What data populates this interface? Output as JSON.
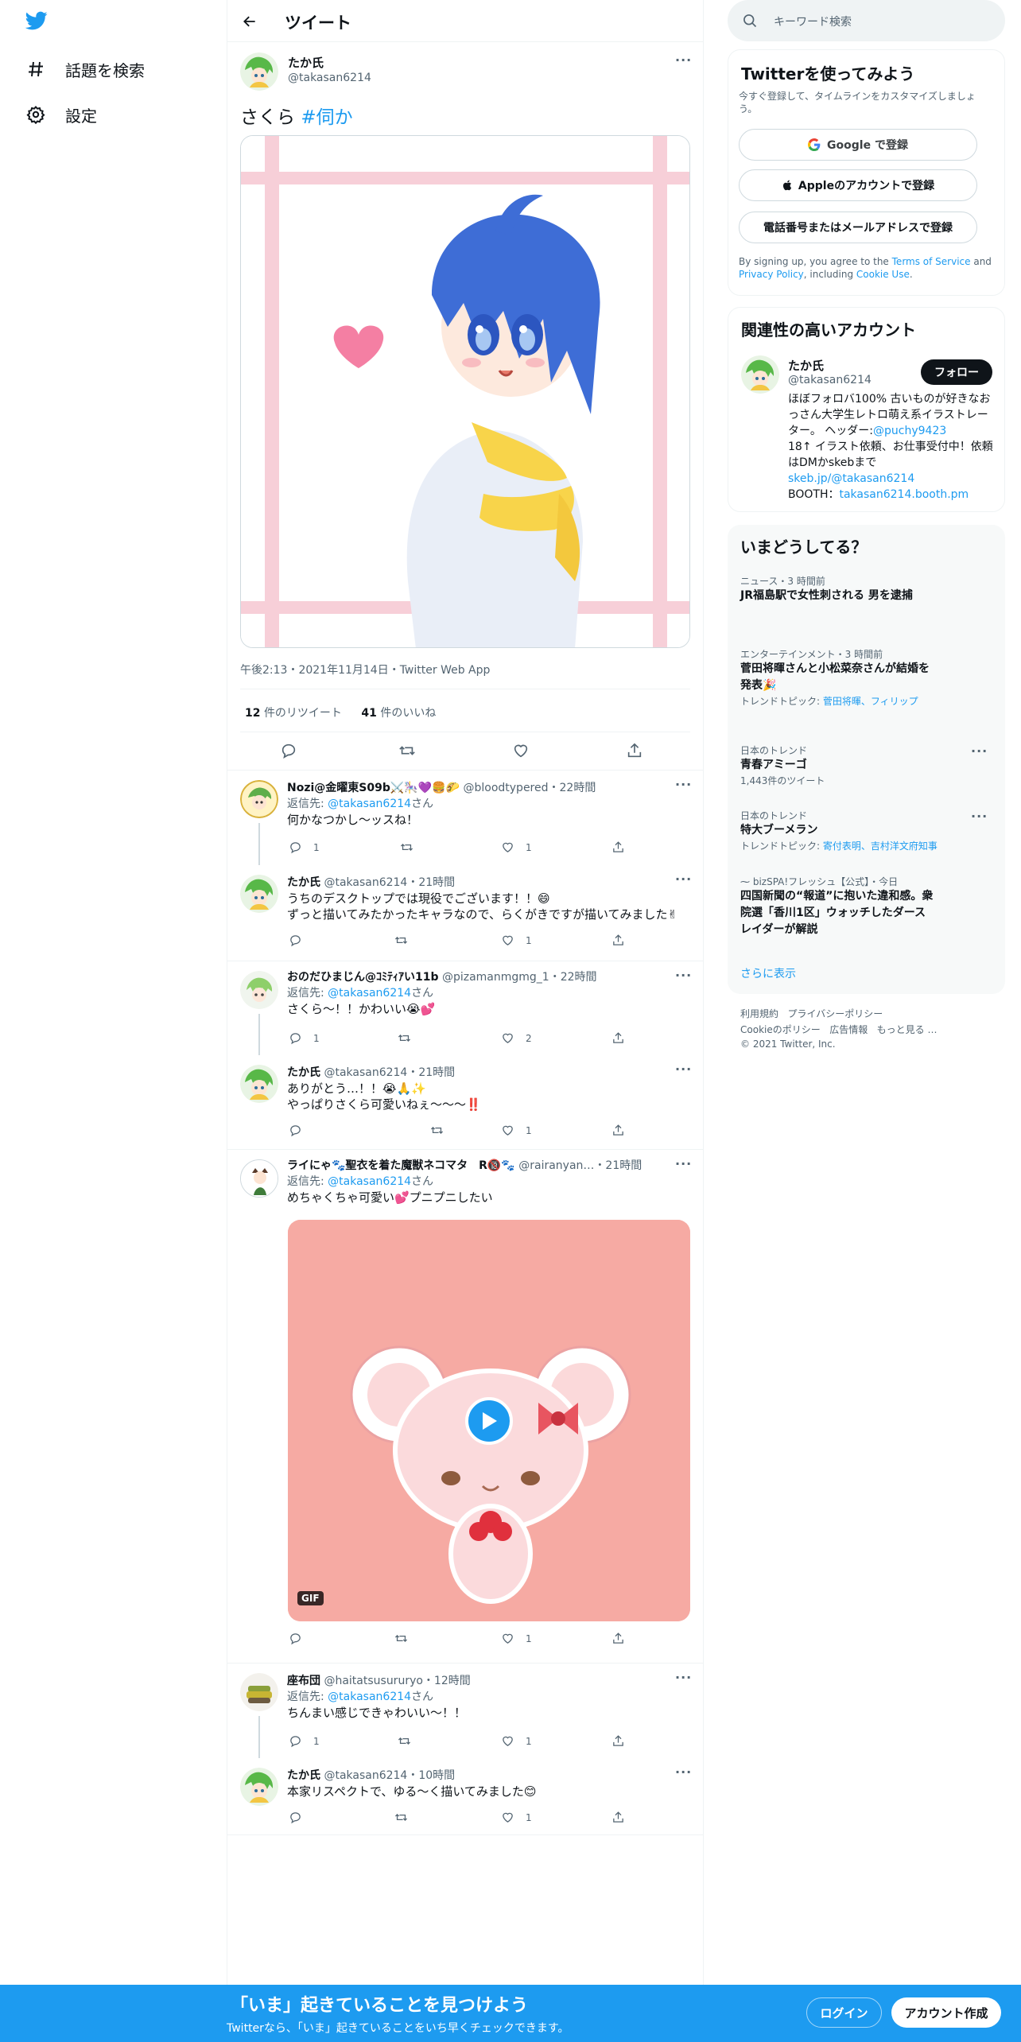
{
  "nav": {
    "explore_label": "話題を検索",
    "settings_label": "設定"
  },
  "header": {
    "title": "ツイート"
  },
  "tweet": {
    "display_name": "たか氏",
    "handle": "@takasan6214",
    "text_main": "さくら",
    "hashtag": "#伺か",
    "meta": "午後2:13・2021年11月14日・Twitter Web App",
    "retweets_count": "12",
    "retweets_label": "件のリツイート",
    "likes_count": "41",
    "likes_label": "件のいいね"
  },
  "replies": [
    {
      "name": "Nozi@金曜東S09b⚔️🎠💜🍔🌮",
      "handle": "@bloodtypered",
      "time": "・22時間",
      "to_prefix": "返信先: ",
      "to_handle": "@takasan6214",
      "to_suffix": "さん",
      "text": "何かなつかし〜ッスね！",
      "reply_count": "1",
      "like_count": "1"
    },
    {
      "name": "たか氏",
      "handle": "@takasan6214",
      "time": "・21時間",
      "text": "うちのデスクトップでは現役でございます！！😄",
      "text2": "ずっと描いてみたかったキャラなので、らくがきですが描いてみました✌",
      "like_count": "1"
    },
    {
      "name": "おのだひまじん@ｺﾐﾃｨｱい11b",
      "handle": "@pizamanmgmg_1",
      "time": "・22時間",
      "to_prefix": "返信先: ",
      "to_handle": "@takasan6214",
      "to_suffix": "さん",
      "text": "さくら〜！！かわいい😭💕",
      "reply_count": "1",
      "like_count": "2"
    },
    {
      "name": "たか氏",
      "handle": "@takasan6214",
      "time": "・21時間",
      "text": "ありがとう…！！😭🙏✨",
      "text2": "やっぱりさくら可愛いねぇ～～～‼️",
      "like_count": "1"
    },
    {
      "name": "ライにゃ🐾聖衣を着た魔獣ネコマタ　R🔞🐾",
      "handle": "@rairanyan…",
      "time": "・21時間",
      "to_prefix": "返信先: ",
      "to_handle": "@takasan6214",
      "to_suffix": "さん",
      "text": "めちゃくちゃ可愛い💕プニプニしたい",
      "gif_label": "GIF",
      "like_count": "1"
    },
    {
      "name": "座布団",
      "handle": "@haitatsusururyo",
      "time": "・12時間",
      "to_prefix": "返信先: ",
      "to_handle": "@takasan6214",
      "to_suffix": "さん",
      "text": "ちんまい感じできゃわいい～！！",
      "reply_count": "1",
      "like_count": "1"
    },
    {
      "name": "たか氏",
      "handle": "@takasan6214",
      "time": "・10時間",
      "text": "本家リスペクトで、ゆる～く描いてみました😊",
      "like_count": "1"
    }
  ],
  "search": {
    "placeholder": "キーワード検索"
  },
  "signup_card": {
    "title": "Twitterを使ってみよう",
    "subtitle": "今すぐ登録して、タイムラインをカスタマイズしましょう。",
    "google": "Google で登録",
    "apple": "Appleのアカウントで登録",
    "phone": "電話番号またはメールアドレスで登録",
    "legal_1": "By signing up, you agree to the ",
    "terms": "Terms of Service",
    "legal_2": " and ",
    "privacy": "Privacy Policy",
    "legal_3": ", including ",
    "cookie": "Cookie Use",
    "legal_4": "."
  },
  "related": {
    "title": "関連性の高いアカウント",
    "name": "たか氏",
    "handle": "@takasan6214",
    "follow": "フォロー",
    "bio_1": "ほぼフォロバ100% 古いものが好きなおっさん大学生レトロ萌え系イラストレーター。 ヘッダー:",
    "bio_link1": "@puchy9423",
    "bio_2": "18↑ イラスト依頼、お仕事受付中！依頼はDMかskebまで",
    "bio_link2": "skeb.jp/@takasan6214",
    "bio_3": "BOOTH：",
    "bio_link3": "takasan6214.booth.pm"
  },
  "trends": {
    "title": "いまどうしてる？",
    "items": [
      {
        "ctx": "ニュース・3 時間前",
        "title": "JR福島駅で女性刺される 男を逮捕"
      },
      {
        "ctx": "エンターテインメント・3 時間前",
        "title": "菅田将暉さんと小松菜奈さんが結婚を発表🎉",
        "sub_prefix": "トレンドトピック: ",
        "sub_link": "菅田将暉、フィリップ"
      },
      {
        "ctx": "日本のトレンド",
        "title": "青春アミーゴ",
        "sub": "1,443件のツイート"
      },
      {
        "ctx": "日本のトレンド",
        "title": "特大ブーメラン",
        "sub_prefix": "トレンドトピック: ",
        "sub_link": "寄付表明、吉村洋文府知事"
      },
      {
        "ctx": "bizSPA!フレッシュ【公式】・今日",
        "title": "四国新聞の“報道”に抱いた違和感。衆院選「香川1区」ウォッチしたダースレイダーが解説"
      }
    ],
    "show_more": "さらに表示"
  },
  "footer": {
    "l1": "利用規約",
    "l2": "プライバシーポリシー",
    "l3": "Cookieのポリシー",
    "l4": "広告情報",
    "l5": "もっと見る …",
    "copyright": "© 2021 Twitter, Inc."
  },
  "bottom": {
    "headline": "「いま」起きていることを見つけよう",
    "sub": "Twitterなら、「いま」起きていることをいち早くチェックできます。",
    "login": "ログイン",
    "signup": "アカウント作成"
  },
  "colors": {
    "accent": "#1d9bf0",
    "text": "#0f1419",
    "muted": "#536471"
  }
}
